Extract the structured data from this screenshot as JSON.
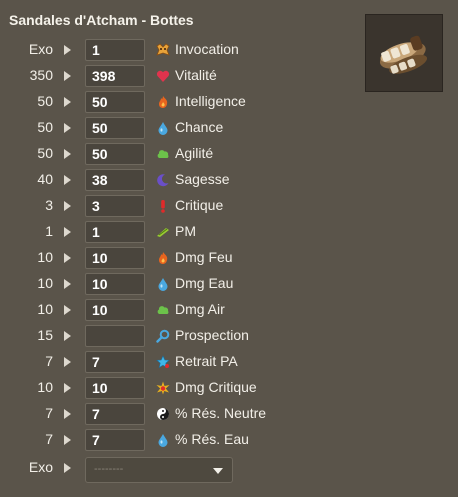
{
  "title": "Sandales d'Atcham - Bottes",
  "item_image": "sandal-boots-icon",
  "rows": [
    {
      "base": "Exo",
      "value": "1",
      "stat": "Invocation",
      "icon": "invocation-icon"
    },
    {
      "base": "350",
      "value": "398",
      "stat": "Vitalité",
      "icon": "heart-icon"
    },
    {
      "base": "50",
      "value": "50",
      "stat": "Intelligence",
      "icon": "fire-icon"
    },
    {
      "base": "50",
      "value": "50",
      "stat": "Chance",
      "icon": "water-drop-icon"
    },
    {
      "base": "50",
      "value": "50",
      "stat": "Agilité",
      "icon": "air-cloud-icon"
    },
    {
      "base": "40",
      "value": "38",
      "stat": "Sagesse",
      "icon": "moon-icon"
    },
    {
      "base": "3",
      "value": "3",
      "stat": "Critique",
      "icon": "exclamation-icon"
    },
    {
      "base": "1",
      "value": "1",
      "stat": "PM",
      "icon": "boot-icon"
    },
    {
      "base": "10",
      "value": "10",
      "stat": "Dmg Feu",
      "icon": "fire-icon"
    },
    {
      "base": "10",
      "value": "10",
      "stat": "Dmg Eau",
      "icon": "water-drop-icon"
    },
    {
      "base": "10",
      "value": "10",
      "stat": "Dmg Air",
      "icon": "air-cloud-icon"
    },
    {
      "base": "15",
      "value": "",
      "stat": "Prospection",
      "icon": "magnifier-icon"
    },
    {
      "base": "7",
      "value": "7",
      "stat": "Retrait PA",
      "icon": "star-icon"
    },
    {
      "base": "10",
      "value": "10",
      "stat": "Dmg Critique",
      "icon": "critical-burst-icon"
    },
    {
      "base": "7",
      "value": "7",
      "stat": "% Rés. Neutre",
      "icon": "yin-yang-icon"
    },
    {
      "base": "7",
      "value": "7",
      "stat": "% Rés. Eau",
      "icon": "water-drop-icon"
    }
  ],
  "exo_row": {
    "base": "Exo",
    "placeholder": "--------"
  },
  "colors": {
    "background": "#5a544a",
    "input_bg": "#4a453d",
    "fire": "#e8641e",
    "water": "#4aa8e0",
    "air": "#6cc24a",
    "heart": "#e0334d",
    "moon": "#6a4fc8"
  }
}
